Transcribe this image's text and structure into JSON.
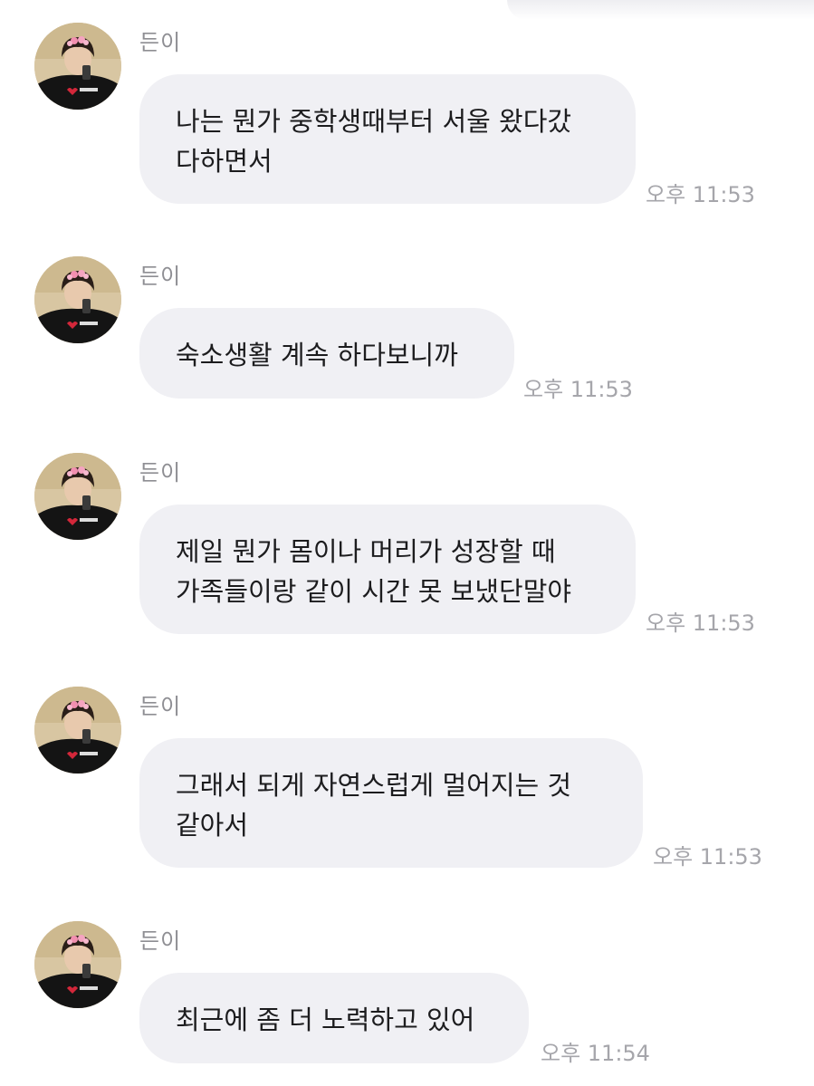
{
  "conversation": {
    "messages": [
      {
        "sender": "든이",
        "text": "나는 뭔가 중학생때부터 서울 왔다갔\n다하면서",
        "time": "오후 11:53"
      },
      {
        "sender": "든이",
        "text": "숙소생활 계속 하다보니까",
        "time": "오후 11:53"
      },
      {
        "sender": "든이",
        "text": "제일 뭔가 몸이나 머리가 성장할 때\n가족들이랑 같이 시간 못 보냈단말야",
        "time": "오후 11:53"
      },
      {
        "sender": "든이",
        "text": "그래서 되게 자연스럽게 멀어지는 것\n같아서",
        "time": "오후 11:53"
      },
      {
        "sender": "든이",
        "text": "최근에 좀 더 노력하고 있어",
        "time": "오후 11:54"
      }
    ]
  },
  "colors": {
    "bubble": "#f0f0f4",
    "message_text": "#1c1c1e",
    "sender_text": "#8e8e93",
    "time_text": "#a6a6ab"
  },
  "icons": {
    "avatar": "profile-photo-avatar"
  }
}
